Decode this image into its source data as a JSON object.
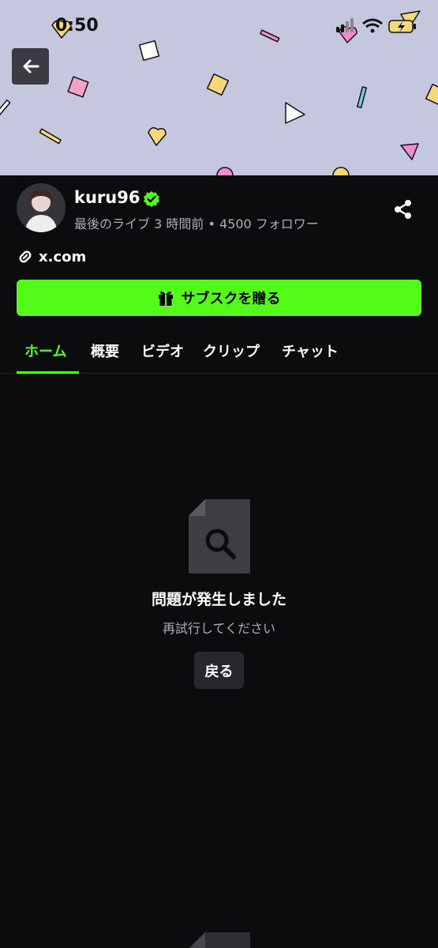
{
  "status_bar": {
    "time": "0:50"
  },
  "channel": {
    "name": "kuru96",
    "meta": "最後のライブ 3 時間前 • 4500 フォロワー",
    "link": "x.com"
  },
  "actions": {
    "gift_label": "サブスクを贈る"
  },
  "tabs": [
    {
      "label": "ホーム",
      "active": true
    },
    {
      "label": "概要",
      "active": false
    },
    {
      "label": "ビデオ",
      "active": false
    },
    {
      "label": "クリップ",
      "active": false
    },
    {
      "label": "チャット",
      "active": false
    }
  ],
  "error": {
    "title": "問題が発生しました",
    "subtitle": "再試行してください",
    "back_label": "戻る"
  },
  "colors": {
    "accent": "#53fc18",
    "background": "#0b0c0e",
    "banner": "#c4c7de"
  },
  "icons": [
    "back-arrow-icon",
    "verified-icon",
    "share-icon",
    "link-icon",
    "gift-icon",
    "document-search-icon"
  ]
}
